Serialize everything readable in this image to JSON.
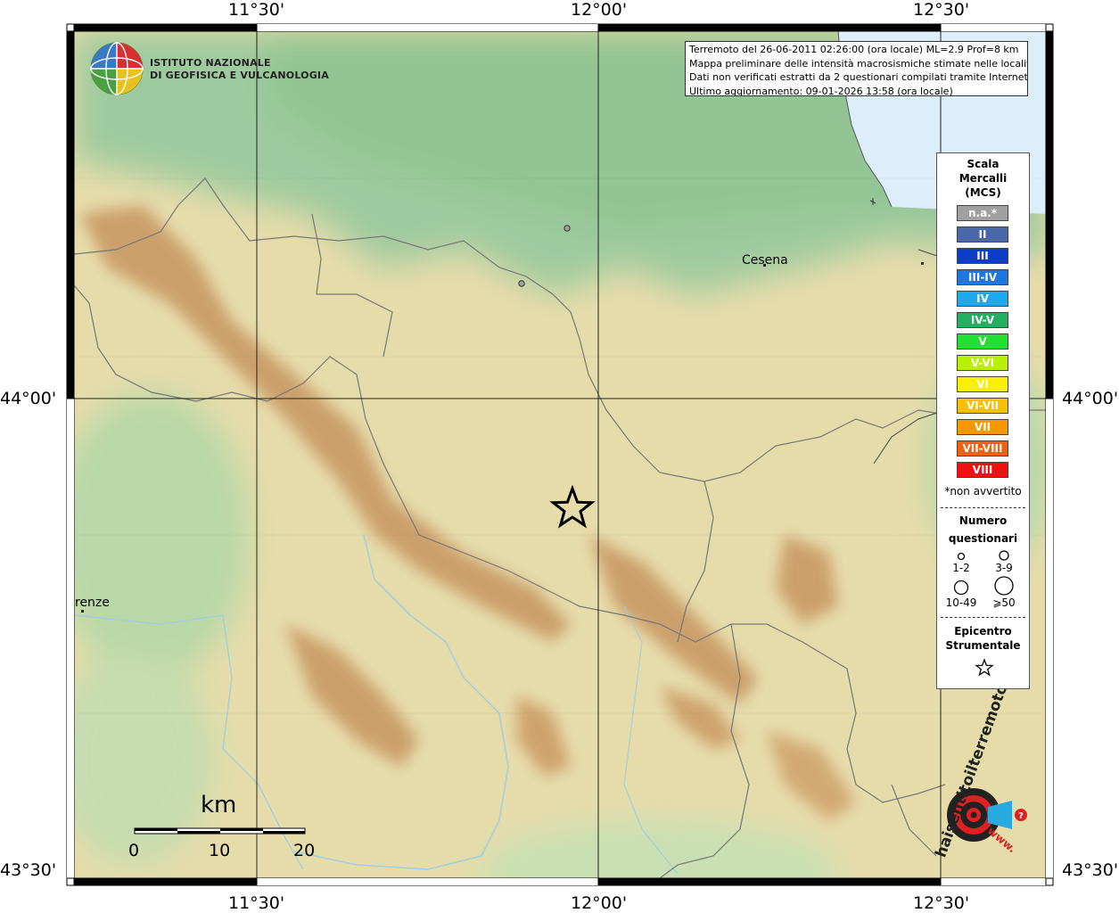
{
  "institute": {
    "line1": "ISTITUTO NAZIONALE",
    "line2": "DI GEOFISICA E VULCANOLOGIA"
  },
  "info": {
    "line1": "Terremoto del 26-06-2011 02:26:00 (ora locale) ML=2.9 Prof=8 km",
    "line2": "Mappa preliminare delle intensità macrosismiche stimate nelle località",
    "line3": "Dati non verificati estratti da 2 questionari compilati tramite Internet.",
    "line4": "Ultimo aggiornamento: 09-01-2026 13:58 (ora locale)"
  },
  "axes": {
    "lon_labels": [
      "11°30'",
      "12°00'",
      "12°30'"
    ],
    "lat_labels": [
      "44°00'",
      "43°30'"
    ]
  },
  "places": {
    "cesena": "Cesena",
    "firenze": "renze"
  },
  "legend": {
    "title": [
      "Scala",
      "Mercalli",
      "(MCS)"
    ],
    "items": [
      {
        "label": "n.a.*",
        "color": "#a0a0a0"
      },
      {
        "label": "II",
        "color": "#4a68a8"
      },
      {
        "label": "III",
        "color": "#0c3cc8"
      },
      {
        "label": "III-IV",
        "color": "#1c78e0"
      },
      {
        "label": "IV",
        "color": "#1ea8ee"
      },
      {
        "label": "IV-V",
        "color": "#20b060"
      },
      {
        "label": "V",
        "color": "#20e030"
      },
      {
        "label": "V-VI",
        "color": "#b8f000"
      },
      {
        "label": "VI",
        "color": "#f8f000"
      },
      {
        "label": "VI-VII",
        "color": "#f8c000"
      },
      {
        "label": "VII",
        "color": "#f89800"
      },
      {
        "label": "VII-VIII",
        "color": "#f06010"
      },
      {
        "label": "VIII",
        "color": "#f01010"
      }
    ],
    "note": "*non avvertito",
    "questionnaires_title": [
      "Numero",
      "questionari"
    ],
    "sizes": [
      "1-2",
      "3-9",
      "10-49",
      "⩾50"
    ],
    "epicenter_title": [
      "Epicentro",
      "Strumentale"
    ]
  },
  "scalebar": {
    "unit": "km",
    "ticks": [
      "0",
      "10",
      "20"
    ]
  },
  "logo": {
    "text": "haisentitoilterremoto.it",
    "url": "www."
  },
  "colors": {
    "sea": "#dbeefa",
    "plain_green": "#9cc89c",
    "hill": "#e8dca8",
    "mountain": "#c89a68"
  }
}
